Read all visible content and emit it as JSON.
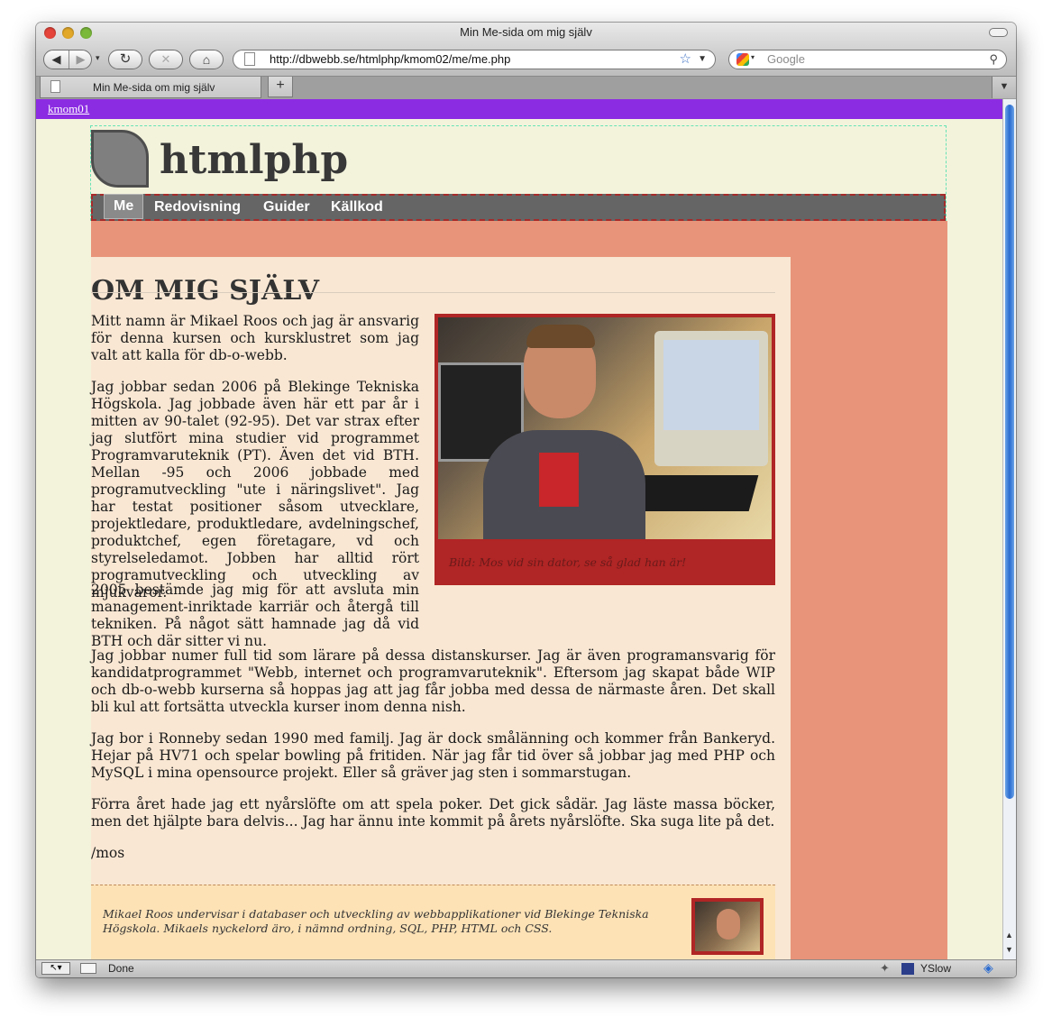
{
  "browser": {
    "window_title": "Min Me-sida om mig själv",
    "url": "http://dbwebb.se/htmlphp/kmom02/me/me.php",
    "search_placeholder": "Google",
    "tab_title": "Min Me-sida om mig själv",
    "new_tab_glyph": "+",
    "status_text": "Done",
    "yslow_label": "YSlow"
  },
  "page": {
    "kmom_link": "kmom01",
    "site_title": "htmlphp",
    "nav": [
      {
        "label": "Me",
        "active": true
      },
      {
        "label": "Redovisning"
      },
      {
        "label": "Guider"
      },
      {
        "label": "Källkod"
      }
    ],
    "article_title": "OM MIG SJÄLV",
    "paragraphs": [
      "Mitt namn är Mikael Roos och jag är ansvarig för denna kursen och kursklustret som jag valt att kalla för db-o-webb.",
      "Jag jobbar sedan 2006 på Blekinge Tekniska Högskola. Jag jobbade även här ett par år i mitten av 90-talet (92-95). Det var strax efter jag slutfört mina studier vid programmet Programvaruteknik (PT). Även det vid BTH. Mellan -95 och 2006 jobbade med programutveckling \"ute i näringslivet\". Jag har testat positioner såsom utvecklare, projektledare, produktledare, avdelningschef, produktchef, egen företagare, vd och styrelseledamot. Jobben har alltid rört programutveckling och utveckling av mjukvaror.",
      "2005 bestämde jag mig för att avsluta min management-inriktade karriär och återgå till tekniken. På något sätt hamnade jag då vid BTH och där sitter vi nu.",
      "Jag jobbar numer full tid som lärare på dessa distanskurser. Jag är även programansvarig för kandidatprogrammet \"Webb, internet och programvaruteknik\". Eftersom jag skapat både WIP och db-o-webb kurserna så hoppas jag att jag får jobba med dessa de närmaste åren. Det skall bli kul att fortsätta utveckla kurser inom denna nish.",
      "Jag bor i Ronneby sedan 1990 med familj. Jag är dock smålänning och kommer från Bankeryd. Hejar på HV71 och spelar bowling på fritiden. När jag får tid över så jobbar jag med PHP och MySQL i mina opensource projekt. Eller så gräver jag sten i sommarstugan.",
      "Förra året hade jag ett nyårslöfte om att spela poker. Det gick sådär. Jag läste massa böcker, men det hjälpte bara delvis... Jag har ännu inte kommit på årets nyårslöfte. Ska suga lite på det.",
      "/mos"
    ],
    "figure_caption": "Bild: Mos vid sin dator, se så glad han är!",
    "byline": "Mikael Roos undervisar i databaser och utveckling av webbapplikationer vid Blekinge Tekniska Högskola. Mikaels nyckelord äro, i nämnd ordning, SQL, PHP, HTML och CSS."
  },
  "colors": {
    "top_strip": "#8b2be2",
    "page_bg": "#f3f3dc",
    "salmon": "#e8947a",
    "article_bg": "#f9e7d3",
    "figure_frame": "#b02525",
    "byline_bg": "#fde2b6"
  },
  "icons": [
    "back-icon",
    "forward-icon",
    "reload-icon",
    "stop-icon",
    "home-icon",
    "page-icon",
    "bookmark-star-icon",
    "google-icon",
    "magnifier-icon",
    "tab-page-icon",
    "tab-list-icon",
    "status-arrow-icon",
    "yslow-icon"
  ]
}
